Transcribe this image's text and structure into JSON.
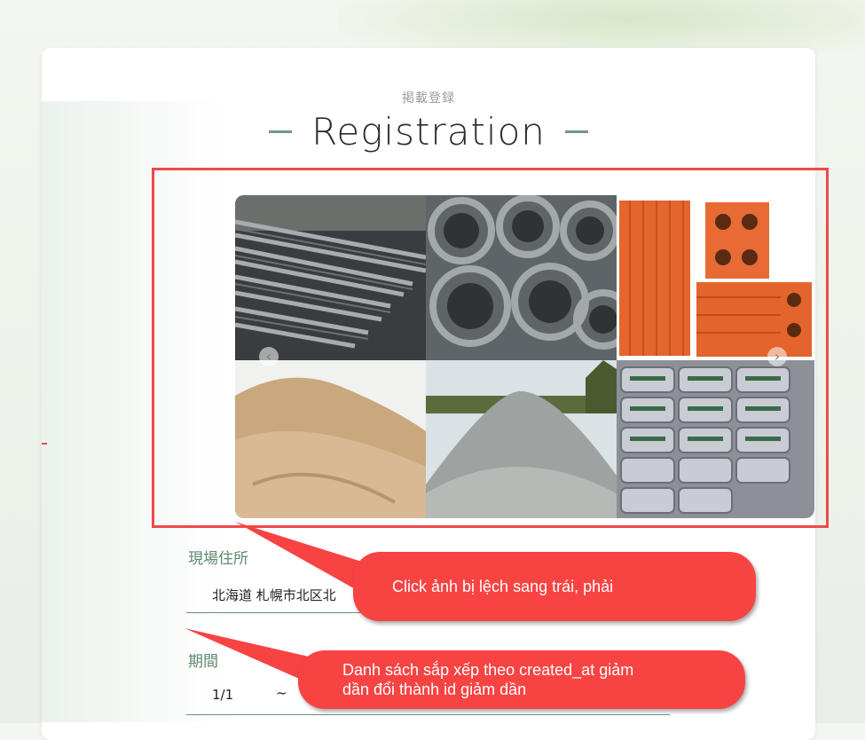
{
  "header": {
    "subtitle": "掲載登録",
    "title": "Registration"
  },
  "carousel": {
    "images": [
      "steel-rebar",
      "wire-coils",
      "clay-bricks",
      "sand-pile",
      "gravel-pile",
      "cement-bags"
    ],
    "prev_icon": "‹",
    "next_icon": "›"
  },
  "form": {
    "address_label": "現場住所",
    "address_value": "北海道 札幌市北区北",
    "period_label": "期間",
    "period_start": "1/1",
    "period_separator": "~"
  },
  "annotations": {
    "callout_1": "Click ảnh bị lệch sang trái, phải",
    "callout_2_line1": "Danh sách sắp xếp theo created_at giảm",
    "callout_2_line2": "dần đổi thành id giảm dần",
    "color": "#f84343"
  }
}
